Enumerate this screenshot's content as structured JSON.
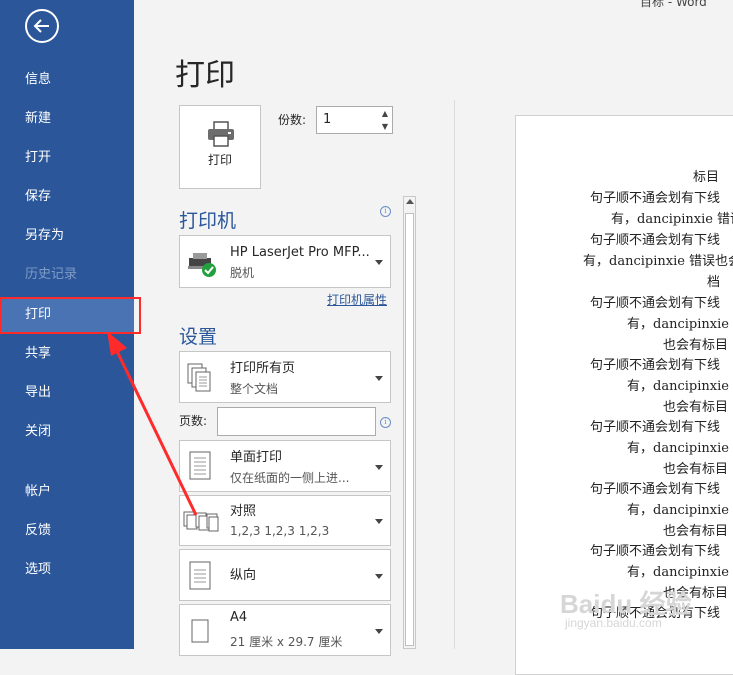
{
  "window": {
    "title": "目标 - Word"
  },
  "sidebar": {
    "back_label": "",
    "items": [
      {
        "label": "信息"
      },
      {
        "label": "新建"
      },
      {
        "label": "打开"
      },
      {
        "label": "保存"
      },
      {
        "label": "另存为"
      },
      {
        "label": "历史记录"
      },
      {
        "label": "打印"
      },
      {
        "label": "共享"
      },
      {
        "label": "导出"
      },
      {
        "label": "关闭"
      },
      {
        "label": "帐户"
      },
      {
        "label": "反馈"
      },
      {
        "label": "选项"
      }
    ]
  },
  "main": {
    "page_title": "打印",
    "print_button_label": "打印",
    "copies_label": "份数:",
    "copies_value": "1",
    "printer_section": "打印机",
    "printer": {
      "name": "HP LaserJet Pro MFP...",
      "status": "脱机"
    },
    "printer_props_link": "打印机属性",
    "settings_section": "设置",
    "settings": [
      {
        "line1": "打印所有页",
        "line2": "整个文档"
      },
      {
        "line1": "单面打印",
        "line2": "仅在纸面的一侧上进..."
      },
      {
        "line1": "对照",
        "line2": "1,2,3    1,2,3    1,2,3"
      },
      {
        "line1": "纵向",
        "line2": ""
      },
      {
        "line1": "A4",
        "line2": "21 厘米 x 29.7 厘米"
      }
    ],
    "pages_label": "页数:",
    "pages_placeholder": ""
  },
  "preview": {
    "lines": [
      "标目",
      "句子顺不通会划有下线",
      "有，dancipinxie 错误也",
      "句子顺不通会划有下线",
      "有，dancipinxie 错误也会",
      "档",
      "句子顺不通会划有下线",
      "有，dancipinxie 错",
      "也会有标目",
      "句子顺不通会划有下线",
      "有，dancipinxie 错",
      "也会有标目",
      "句子顺不通会划有下线",
      "有，dancipinxie 错",
      "也会有标目",
      "句子顺不通会划有下线",
      "有，dancipinxie 错",
      "也会有标目",
      "句子顺不通会划有下线",
      "有，dancipinxie 错",
      "也会有标目",
      "句子顺不通会划有下线"
    ],
    "watermark": "Baidu 经验",
    "watermark_url": "jingyan.baidu.com"
  },
  "colors": {
    "sidebar": "#2b579a",
    "active": "#4a73b3",
    "highlight": "#ff2a2a"
  }
}
